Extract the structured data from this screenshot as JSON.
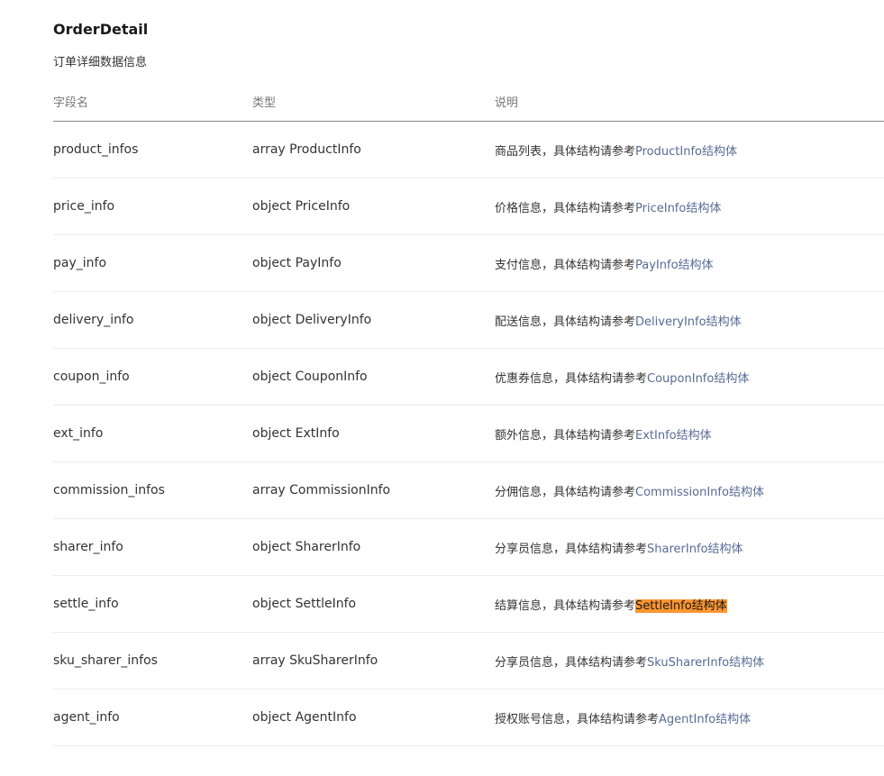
{
  "header": {
    "title": "OrderDetail",
    "subtitle": "订单详细数据信息"
  },
  "table": {
    "columns": [
      "字段名",
      "类型",
      "说明"
    ],
    "rows": [
      {
        "name": "product_infos",
        "type": "array ProductInfo",
        "desc_text": "商品列表，具体结构请参考",
        "link_text": "ProductInfo结构体"
      },
      {
        "name": "price_info",
        "type": "object PriceInfo",
        "desc_text": "价格信息，具体结构请参考",
        "link_text": "PriceInfo结构体"
      },
      {
        "name": "pay_info",
        "type": "object PayInfo",
        "desc_text": "支付信息，具体结构请参考",
        "link_text": "PayInfo结构体"
      },
      {
        "name": "delivery_info",
        "type": "object DeliveryInfo",
        "desc_text": "配送信息，具体结构请参考",
        "link_text": "DeliveryInfo结构体"
      },
      {
        "name": "coupon_info",
        "type": "object CouponInfo",
        "desc_text": "优惠券信息，具体结构请参考",
        "link_text": "CouponInfo结构体"
      },
      {
        "name": "ext_info",
        "type": "object ExtInfo",
        "desc_text": "额外信息，具体结构请参考",
        "link_text": "ExtInfo结构体"
      },
      {
        "name": "commission_infos",
        "type": "array CommissionInfo",
        "desc_text": "分佣信息，具体结构请参考",
        "link_text": "CommissionInfo结构体"
      },
      {
        "name": "sharer_info",
        "type": "object SharerInfo",
        "desc_text": "分享员信息，具体结构请参考",
        "link_text": "SharerInfo结构体"
      },
      {
        "name": "settle_info",
        "type": "object SettleInfo",
        "desc_text": "结算信息，具体结构请参考",
        "link_text": "SettleInfo结构体",
        "highlighted": true
      },
      {
        "name": "sku_sharer_infos",
        "type": "array SkuSharerInfo",
        "desc_text": "分享员信息，具体结构请参考",
        "link_text": "SkuSharerInfo结构体"
      },
      {
        "name": "agent_info",
        "type": "object AgentInfo",
        "desc_text": "授权账号信息，具体结构请参考",
        "link_text": "AgentInfo结构体"
      }
    ]
  },
  "colors": {
    "link": "#576b95",
    "highlight": "#ff9632"
  }
}
